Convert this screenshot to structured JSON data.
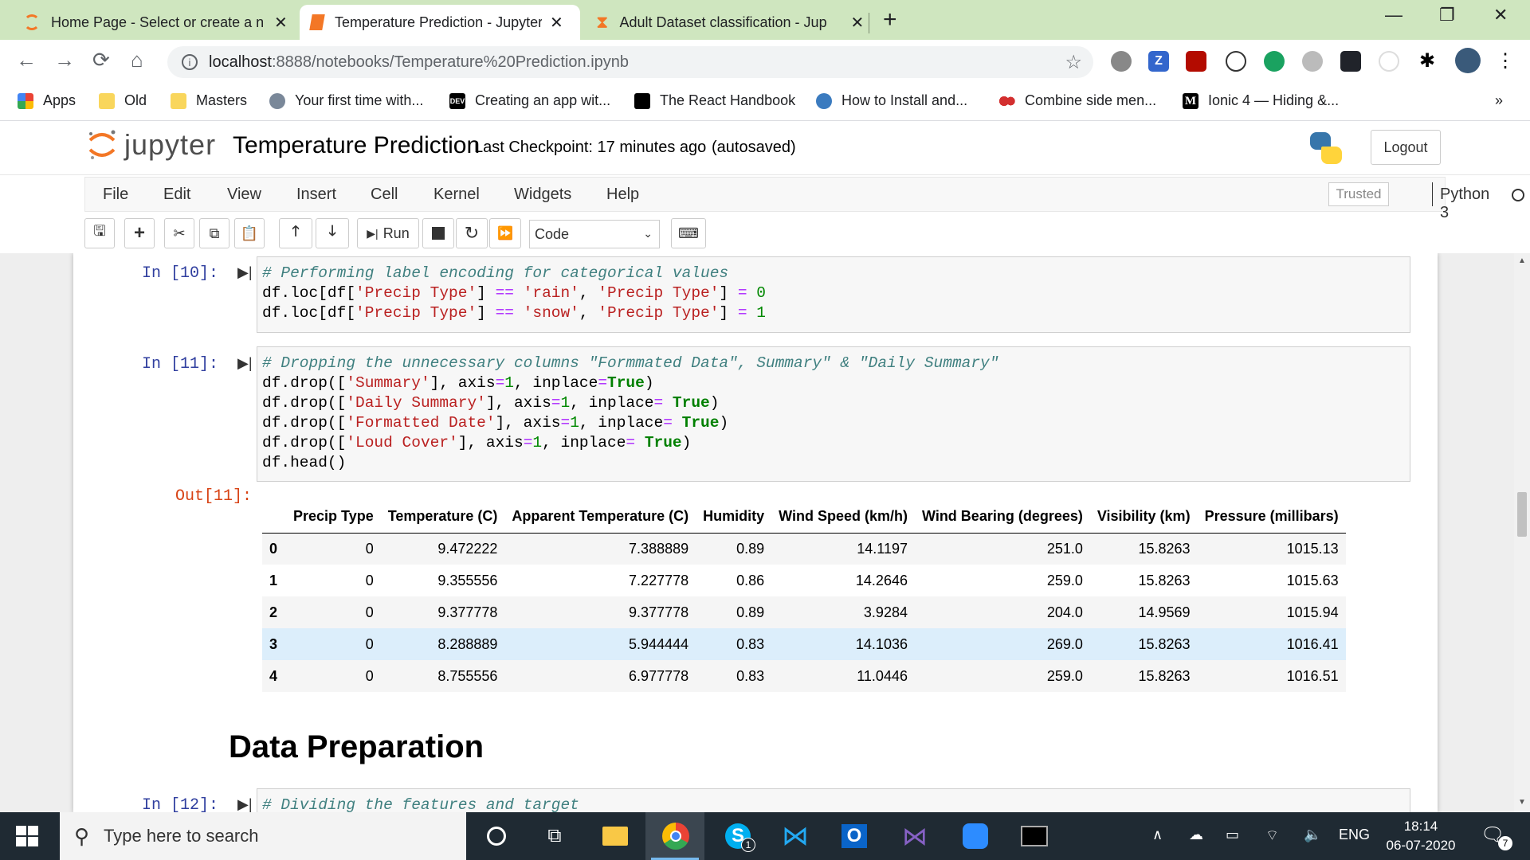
{
  "browser": {
    "tabs": [
      {
        "title": "Home Page - Select or create a n",
        "active": false
      },
      {
        "title": "Temperature Prediction - Jupyter",
        "active": true
      },
      {
        "title": "Adult Dataset classification - Jup",
        "active": false
      }
    ],
    "url_host": "localhost",
    "url_path": ":8888/notebooks/Temperature%20Prediction.ipynb",
    "bookmarks": [
      "Apps",
      "Old",
      "Masters",
      "Your first time with...",
      "Creating an app wit...",
      "The React Handbook",
      "How to Install and...",
      "Combine side men...",
      "Ionic 4 — Hiding &..."
    ],
    "bookmarks_overflow": "»"
  },
  "jupyter": {
    "logo_text": "jupyter",
    "notebook_name": "Temperature Prediction",
    "checkpoint": "Last Checkpoint: 17 minutes ago",
    "autosave": "(autosaved)",
    "logout_label": "Logout",
    "menus": [
      "File",
      "Edit",
      "View",
      "Insert",
      "Cell",
      "Kernel",
      "Widgets",
      "Help"
    ],
    "trusted_label": "Trusted",
    "kernel_name": "Python 3",
    "run_label": "Run",
    "cell_type": "Code"
  },
  "cells": {
    "cell10_prompt": "In [10]:",
    "cell11_prompt": "In [11]:",
    "out11_prompt": "Out[11]:",
    "cell12_prompt": "In [12]:",
    "cell12_code": "# Dividing the features and target",
    "section_heading": "Data Preparation"
  },
  "dataframe": {
    "columns": [
      "Precip Type",
      "Temperature (C)",
      "Apparent Temperature (C)",
      "Humidity",
      "Wind Speed (km/h)",
      "Wind Bearing (degrees)",
      "Visibility (km)",
      "Pressure (millibars)"
    ],
    "rows": [
      [
        "0",
        "0",
        "9.472222",
        "7.388889",
        "0.89",
        "14.1197",
        "251.0",
        "15.8263",
        "1015.13"
      ],
      [
        "1",
        "0",
        "9.355556",
        "7.227778",
        "0.86",
        "14.2646",
        "259.0",
        "15.8263",
        "1015.63"
      ],
      [
        "2",
        "0",
        "9.377778",
        "9.377778",
        "0.89",
        "3.9284",
        "204.0",
        "14.9569",
        "1015.94"
      ],
      [
        "3",
        "0",
        "8.288889",
        "5.944444",
        "0.83",
        "14.1036",
        "269.0",
        "15.8263",
        "1016.41"
      ],
      [
        "4",
        "0",
        "8.755556",
        "6.977778",
        "0.83",
        "11.0446",
        "259.0",
        "15.8263",
        "1016.51"
      ]
    ],
    "highlighted_row": 3
  },
  "taskbar": {
    "search_placeholder": "Type here to search",
    "lang": "ENG",
    "time": "18:14",
    "date": "06-07-2020",
    "notification_count": "7",
    "skype_badge": "1"
  }
}
